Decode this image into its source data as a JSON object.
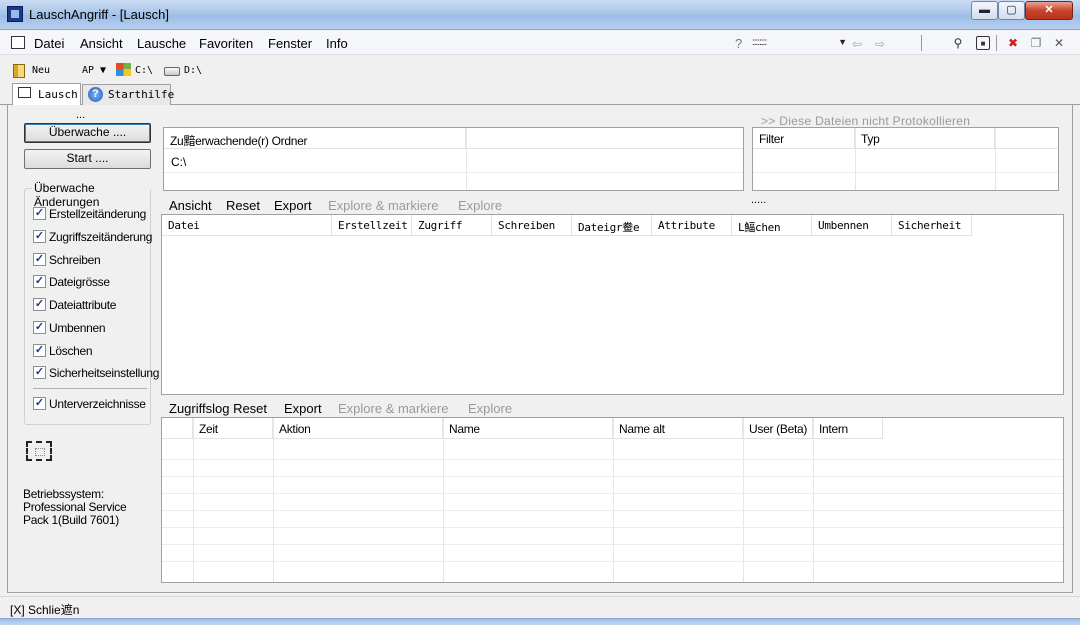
{
  "window": {
    "title": "LauschAngriff - [Lausch]",
    "minimize": "▬",
    "maximize": "▢",
    "close": "✕"
  },
  "menu": {
    "items": [
      "Datei",
      "Ansicht",
      "Lausche",
      "Favoriten",
      "Fenster",
      "Info"
    ],
    "help": "?",
    "language_value": "::::::::"
  },
  "toolbar": {
    "new_label": "Neu",
    "ap_label": "AP ▼",
    "drive_c": "C:\\",
    "drive_d": "D:\\"
  },
  "tabs": [
    {
      "label": "Lausch"
    },
    {
      "label": "Starthilfe"
    }
  ],
  "left": {
    "dots": "...",
    "watch_button": "Überwache ....",
    "start_button": "Start ....",
    "group_title": "Überwache Änderungen",
    "checks": [
      {
        "label": "Erstellzeitänderung",
        "checked": true
      },
      {
        "label": "Zugriffszeitänderung",
        "checked": true
      },
      {
        "label": "Schreiben",
        "checked": true
      },
      {
        "label": "Dateigrösse",
        "checked": true
      },
      {
        "label": "Dateiattribute",
        "checked": true
      },
      {
        "label": "Umbennen",
        "checked": true
      },
      {
        "label": "Löschen",
        "checked": true
      },
      {
        "label": "Sicherheitseinstellung",
        "checked": true
      }
    ],
    "subdirs": {
      "label": "Unterverzeichnisse",
      "checked": true
    },
    "os_lines": [
      "Betriebssystem:",
      "Professional Service",
      "Pack 1(Build 7601)"
    ]
  },
  "folders": {
    "header": "Zu黯erwachende(r) Ordner",
    "rows": [
      "C:\\"
    ]
  },
  "exclude": {
    "hint": ">> Diese Dateien nicht Protokollieren",
    "cols": [
      "Filter",
      "Typ"
    ]
  },
  "files_links": {
    "items": [
      "Ansicht",
      "Reset",
      "Export",
      "Explore & markiere",
      "Explore"
    ],
    "disabled_from": 3,
    "dots": "....."
  },
  "files_table": {
    "cols": [
      "Datei",
      "Erstellzeit",
      "Zugriff",
      "Schreiben",
      "Dateigr鲞e",
      "Attribute",
      "L鰏chen",
      "Umbennen",
      "Sicherheit"
    ]
  },
  "log_links": {
    "items": [
      "Zugriffslog Reset",
      "Export",
      "Explore & markiere",
      "Explore"
    ],
    "disabled_from": 2
  },
  "log_table": {
    "cols": [
      "",
      "Zeit",
      "Aktion",
      "Name",
      "Name alt",
      "User (Beta)",
      "Intern"
    ]
  },
  "status": {
    "text": "[X] Schlie遮n"
  }
}
